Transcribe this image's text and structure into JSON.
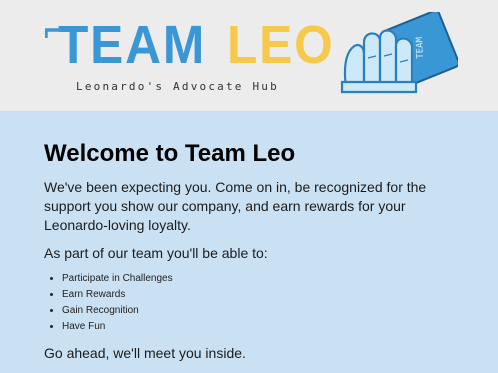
{
  "header": {
    "logo_team": "TEAM",
    "logo_leo": "LEO",
    "subtitle": "Leonardo's Advocate Hub",
    "hand_card_text": "TEAM"
  },
  "main": {
    "heading": "Welcome to Team Leo",
    "intro": "We've been expecting you. Come on in, be recognized for the support you show our company, and earn rewards for your Leonardo-loving loyalty.",
    "lead": "As part of our team you'll be able to:",
    "benefits": [
      "Participate in Challenges",
      "Earn Rewards",
      "Gain Recognition",
      "Have Fun"
    ],
    "outro": "Go ahead, we'll meet you inside."
  },
  "colors": {
    "background": "#c9e1f3",
    "header_bg": "#ececec",
    "brand_blue": "#3a97d6",
    "brand_yellow": "#f6c94a"
  },
  "icons": [
    "logo-corner-mark-icon",
    "hand-holding-card-icon"
  ]
}
